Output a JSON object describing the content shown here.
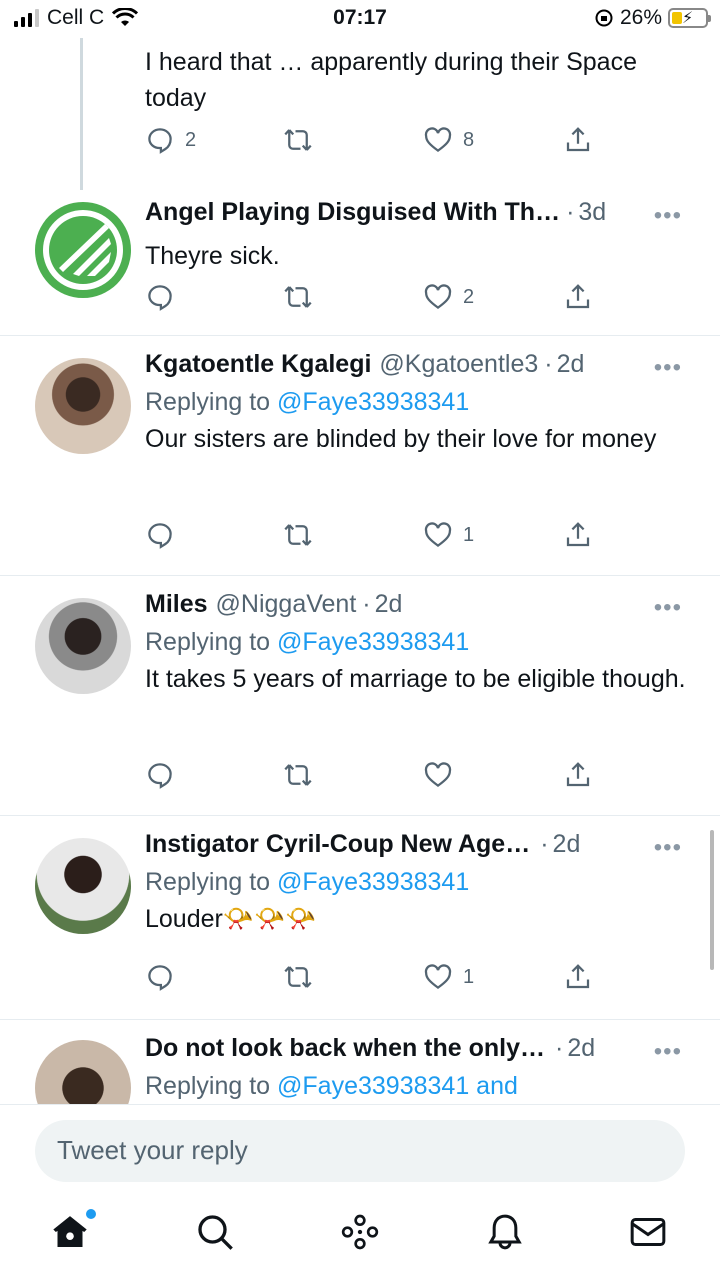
{
  "status_bar": {
    "carrier": "Cell C",
    "time": "07:17",
    "battery": "26%"
  },
  "tweets": [
    {
      "name": "",
      "handle": "",
      "time": "",
      "reply_to": "",
      "text": "I heard that … apparently during their Space today",
      "replies": "2",
      "retweets": "",
      "likes": "8"
    },
    {
      "name": "Angel Playing Disguised With Th…",
      "handle": "",
      "time": "3d",
      "reply_to": "",
      "text": "Theyre sick.",
      "replies": "",
      "retweets": "",
      "likes": "2"
    },
    {
      "name": "Kgatoentle Kgalegi",
      "handle": "@Kgatoentle3",
      "time": "2d",
      "reply_to": "@Faye33938341",
      "text": "Our sisters are blinded by their love for money",
      "replies": "",
      "retweets": "",
      "likes": "1"
    },
    {
      "name": "Miles",
      "handle": "@NiggaVent",
      "time": "2d",
      "reply_to": "@Faye33938341",
      "text": "It takes 5 years of marriage to be eligible though.",
      "replies": "",
      "retweets": "",
      "likes": ""
    },
    {
      "name": "Instigator Cyril-Coup New Age…",
      "handle": "",
      "time": "2d",
      "reply_to": "@Faye33938341",
      "text": "Louder📯📯📯",
      "replies": "",
      "retweets": "",
      "likes": "1"
    },
    {
      "name": "Do not look back when the only…",
      "handle": "",
      "time": "2d",
      "reply_to": "@Faye33938341 and",
      "text": "",
      "replies": "",
      "retweets": "",
      "likes": ""
    }
  ],
  "labels": {
    "replying_to": "Replying to",
    "dot": "·",
    "more": "•••"
  },
  "reply_box": {
    "placeholder": "Tweet your reply"
  },
  "tab_bar": [
    "home-icon",
    "search-icon",
    "spaces-icon",
    "notifications-icon",
    "messages-icon"
  ],
  "colors": {
    "accent": "#1d9bf0",
    "muted": "#536471",
    "logo_green": "#4caf50"
  }
}
